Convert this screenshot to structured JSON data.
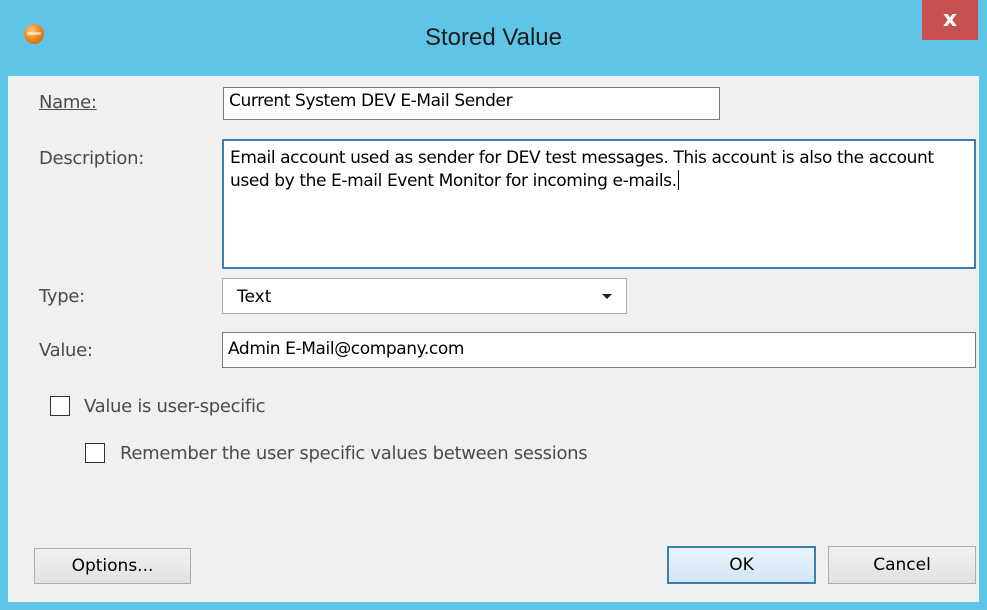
{
  "window": {
    "title": "Stored Value",
    "close_glyph": "x",
    "icon": "orange-sphere-icon"
  },
  "form": {
    "name_label": "Name:",
    "name_value": "Current System DEV E-Mail Sender",
    "description_label": "Description:",
    "description_value": "Email account used as sender for DEV test messages. This account is also the account used by the E-mail Event Monitor for incoming e-mails.",
    "type_label": "Type:",
    "type_value": "Text",
    "value_label": "Value:",
    "value_value": "Admin E-Mail@company.com"
  },
  "options": {
    "user_specific_label": "Value is user-specific",
    "user_specific_checked": false,
    "remember_label": "Remember the user specific values between sessions",
    "remember_checked": false
  },
  "buttons": {
    "options_label": "Options...",
    "ok_label": "OK",
    "cancel_label": "Cancel"
  },
  "colors": {
    "titlebar": "#5ec4e8",
    "close_button": "#c75050",
    "client": "#f0f0f0",
    "focus_border": "#3d7eb6"
  }
}
